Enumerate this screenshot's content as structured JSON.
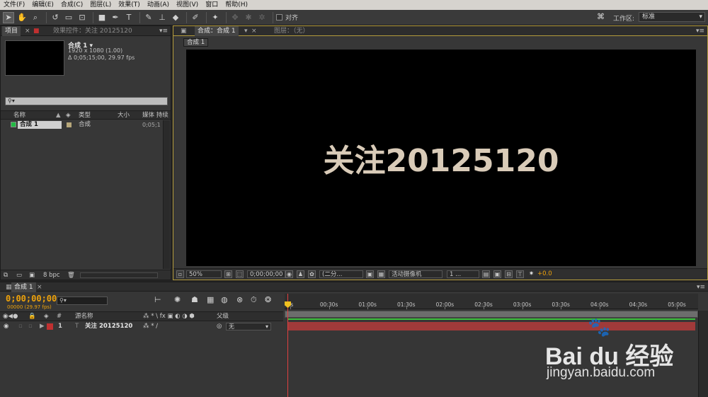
{
  "menubar": {
    "items": [
      "文件(F)",
      "编辑(E)",
      "合成(C)",
      "图层(L)",
      "效果(T)",
      "动画(A)",
      "视图(V)",
      "窗口",
      "帮助(H)"
    ]
  },
  "toolbar": {
    "align_label": "对齐",
    "workspace_label": "工作区:",
    "workspace_value": "标准"
  },
  "project_panel": {
    "tab_project": "项目",
    "tab_effects": "效果控件：关注 20125120",
    "comp_name": "合成 1 ▾",
    "comp_resolution": "1920 x 1080 (1.00)",
    "comp_duration": "Δ 0;05;15;00, 29.97 fps",
    "search_placeholder": "⚲▾",
    "columns": {
      "name": "名称",
      "type": "类型",
      "size": "大小",
      "media_duration": "媒体 持续"
    },
    "items": [
      {
        "name": "合成 1",
        "type": "合成",
        "duration": "0;05;1"
      }
    ],
    "bpc": "8 bpc"
  },
  "viewer": {
    "tab_comp": "合成：合成 1",
    "tab_layer": "图层：（无）",
    "sub_tab": "合成 1",
    "canvas_text": "关注20125120",
    "zoom": "50%",
    "timecode": "0;00;00;00",
    "resolution": "(二分...",
    "camera": "活动摄像机",
    "views": "1 ...",
    "exposure": "+0.0"
  },
  "timeline": {
    "tab": "合成 1",
    "timecode": "0;00;00;00",
    "timecode_sub": "00000 (29.97 fps)",
    "search_placeholder": "⚲▾",
    "header": {
      "num": "#",
      "source_name": "源名称",
      "switches": "⁂ * \\ fx ▣ ◐ ◑ ⬢",
      "parent": "父级"
    },
    "layers": [
      {
        "index": "1",
        "name": "关注 20125120",
        "parent": "无",
        "label_color": "#c03030"
      }
    ],
    "ruler": [
      "0s",
      "00:30s",
      "01:00s",
      "01:30s",
      "02:00s",
      "02:30s",
      "03:00s",
      "03:30s",
      "04:00s",
      "04:30s",
      "05:00s"
    ]
  },
  "watermark": {
    "brand": "Bai du 经验",
    "url": "jingyan.baidu.com"
  },
  "colors": {
    "timecode": "#f0a30a",
    "viewer_border": "#b49b3c",
    "track": "#a03a3a",
    "work_area_line": "#3ec13e"
  }
}
